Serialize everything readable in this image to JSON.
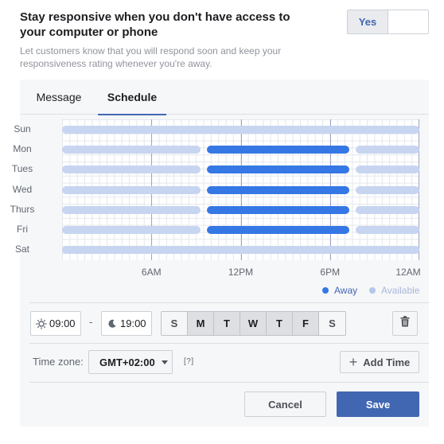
{
  "header": {
    "title": "Stay responsive when you don't have access to your computer or phone",
    "description": "Let customers know that you will respond soon and keep your responsiveness rating whenever you're away."
  },
  "toggle": {
    "on_label": "Yes",
    "state": "on"
  },
  "tabs": [
    {
      "label": "Message",
      "active": false
    },
    {
      "label": "Schedule",
      "active": true
    }
  ],
  "schedule": {
    "days": [
      "Sun",
      "Mon",
      "Tues",
      "Wed",
      "Thurs",
      "Fri",
      "Sat"
    ],
    "time_labels": [
      "6AM",
      "12PM",
      "6PM",
      "12AM"
    ],
    "away_hours": [
      [],
      [
        9.5,
        19.5
      ],
      [
        9.5,
        19.5
      ],
      [
        9.5,
        19.5
      ],
      [
        9.5,
        19.5
      ],
      [
        9.5,
        19.5
      ],
      []
    ],
    "legend": {
      "away": "Away",
      "available": "Available"
    },
    "colors": {
      "away": "#3578e5",
      "available": "#c7d5f0",
      "accent": "#4267b2"
    }
  },
  "time_range": {
    "start": "09:00",
    "start_icon": "sun-icon",
    "separator": "-",
    "end": "19:00",
    "end_icon": "moon-icon"
  },
  "day_buttons": [
    {
      "label": "S",
      "selected": false
    },
    {
      "label": "M",
      "selected": true
    },
    {
      "label": "T",
      "selected": true
    },
    {
      "label": "W",
      "selected": true
    },
    {
      "label": "T",
      "selected": true
    },
    {
      "label": "F",
      "selected": true
    },
    {
      "label": "S",
      "selected": false
    }
  ],
  "timezone": {
    "label": "Time zone:",
    "value": "GMT+02:00",
    "help": "[?]"
  },
  "add_time_label": "Add Time",
  "actions": {
    "cancel": "Cancel",
    "save": "Save"
  }
}
